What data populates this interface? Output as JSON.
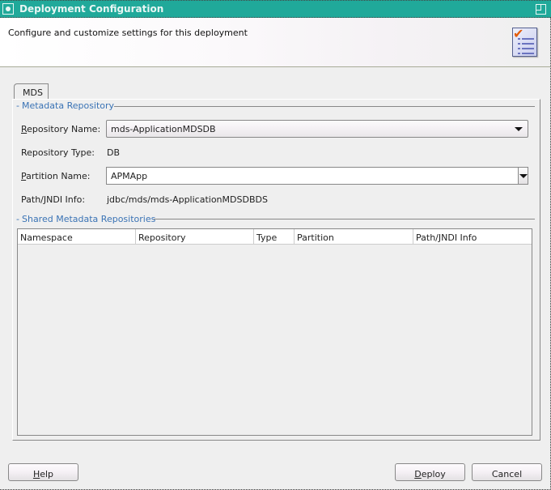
{
  "window": {
    "title": "Deployment Configuration",
    "icon": "window-menu-icon",
    "maximize_icon": "maximize-icon"
  },
  "header": {
    "description": "Configure and customize settings for this deployment",
    "icon": "checklist-icon"
  },
  "tabs": [
    {
      "label": "MDS",
      "selected": true
    }
  ],
  "metadata_repository": {
    "section_title": "Metadata Repository",
    "repository_name": {
      "label_mnemonic": "R",
      "label_rest": "epository Name:",
      "value": "mds-ApplicationMDSDB"
    },
    "repository_type": {
      "label": "Repository Type:",
      "value": "DB"
    },
    "partition_name": {
      "label_mnemonic": "P",
      "label_rest": "artition Name:",
      "value": "APMApp"
    },
    "path_jndi": {
      "label": "Path/JNDI Info:",
      "value": "jdbc/mds/mds-ApplicationMDSDBDS"
    }
  },
  "shared_repositories": {
    "section_title": "Shared Metadata Repositories",
    "columns": [
      "Namespace",
      "Repository",
      "Type",
      "Partition",
      "Path/JNDI Info"
    ],
    "rows": []
  },
  "buttons": {
    "help": {
      "mnemonic": "H",
      "rest": "elp"
    },
    "deploy": {
      "mnemonic": "D",
      "rest": "eploy"
    },
    "cancel": {
      "label": "Cancel"
    }
  },
  "colors": {
    "titlebar": "#20a99a",
    "section_title": "#3a73b5"
  }
}
